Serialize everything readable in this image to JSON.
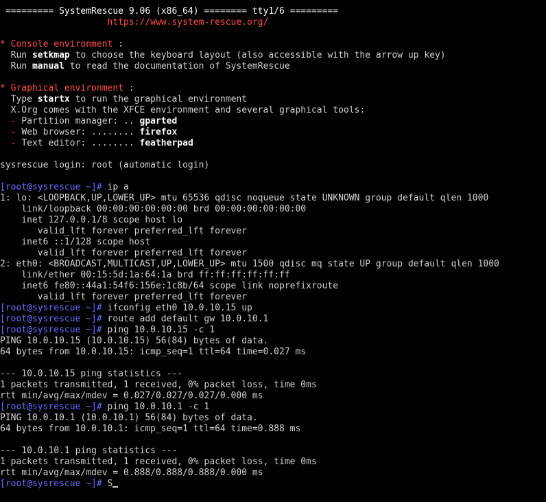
{
  "colors": {
    "background": "#000000",
    "text": "#d2d2d2",
    "bright": "#ffffff",
    "red": "#ff4d4d",
    "prompt": "#6b6bff"
  },
  "lines": [
    {
      "segs": [
        {
          "t": " ========= SystemRescue 9.06 (x86_64) ======== tty1/6 =========",
          "c": "w"
        }
      ]
    },
    {
      "segs": [
        {
          "t": "                    https://www.system-rescue.org/",
          "c": "r"
        }
      ]
    },
    {
      "segs": [
        {
          "t": "",
          "c": ""
        }
      ]
    },
    {
      "segs": [
        {
          "t": "* Console environment",
          "c": "r"
        },
        {
          "t": " :",
          "c": ""
        }
      ]
    },
    {
      "segs": [
        {
          "t": "  Run ",
          "c": ""
        },
        {
          "t": "setkmap",
          "c": "b"
        },
        {
          "t": " to choose the keyboard layout (also accessible with the arrow up key)",
          "c": ""
        }
      ]
    },
    {
      "segs": [
        {
          "t": "  Run ",
          "c": ""
        },
        {
          "t": "manual",
          "c": "b"
        },
        {
          "t": " to read the documentation of SystemRescue",
          "c": ""
        }
      ]
    },
    {
      "segs": [
        {
          "t": "",
          "c": ""
        }
      ]
    },
    {
      "segs": [
        {
          "t": "* Graphical environment",
          "c": "r"
        },
        {
          "t": " :",
          "c": ""
        }
      ]
    },
    {
      "segs": [
        {
          "t": "  Type ",
          "c": ""
        },
        {
          "t": "startx",
          "c": "b"
        },
        {
          "t": " to run the graphical environment",
          "c": ""
        }
      ]
    },
    {
      "segs": [
        {
          "t": "  X.Org comes with the XFCE environment and several graphical tools:",
          "c": ""
        }
      ]
    },
    {
      "segs": [
        {
          "t": "  - ",
          "c": "r"
        },
        {
          "t": "Partition manager: .. ",
          "c": ""
        },
        {
          "t": "gparted",
          "c": "b"
        }
      ]
    },
    {
      "segs": [
        {
          "t": "  - ",
          "c": "r"
        },
        {
          "t": "Web browser: ........ ",
          "c": ""
        },
        {
          "t": "firefox",
          "c": "b"
        }
      ]
    },
    {
      "segs": [
        {
          "t": "  - ",
          "c": "r"
        },
        {
          "t": "Text editor: ........ ",
          "c": ""
        },
        {
          "t": "featherpad",
          "c": "b"
        }
      ]
    },
    {
      "segs": [
        {
          "t": "",
          "c": ""
        }
      ]
    },
    {
      "segs": [
        {
          "t": "sysrescue login: root (automatic login)",
          "c": ""
        }
      ]
    },
    {
      "segs": [
        {
          "t": "",
          "c": ""
        }
      ]
    },
    {
      "segs": [
        {
          "t": "[root@sysrescue ~]#",
          "c": "p"
        },
        {
          "t": " ip a",
          "c": ""
        }
      ]
    },
    {
      "segs": [
        {
          "t": "1: lo: <LOOPBACK,UP,LOWER_UP> mtu 65536 qdisc noqueue state UNKNOWN group default qlen 1000",
          "c": ""
        }
      ]
    },
    {
      "segs": [
        {
          "t": "    link/loopback 00:00:00:00:00:00 brd 00:00:00:00:00:00",
          "c": ""
        }
      ]
    },
    {
      "segs": [
        {
          "t": "    inet 127.0.0.1/8 scope host lo",
          "c": ""
        }
      ]
    },
    {
      "segs": [
        {
          "t": "       valid_lft forever preferred_lft forever",
          "c": ""
        }
      ]
    },
    {
      "segs": [
        {
          "t": "    inet6 ::1/128 scope host",
          "c": ""
        }
      ]
    },
    {
      "segs": [
        {
          "t": "       valid_lft forever preferred_lft forever",
          "c": ""
        }
      ]
    },
    {
      "segs": [
        {
          "t": "2: eth0: <BROADCAST,MULTICAST,UP,LOWER_UP> mtu 1500 qdisc mq state UP group default qlen 1000",
          "c": ""
        }
      ]
    },
    {
      "segs": [
        {
          "t": "    link/ether 00:15:5d:1a:64:1a brd ff:ff:ff:ff:ff:ff",
          "c": ""
        }
      ]
    },
    {
      "segs": [
        {
          "t": "    inet6 fe80::44a1:54f6:156e:1c8b/64 scope link noprefixroute",
          "c": ""
        }
      ]
    },
    {
      "segs": [
        {
          "t": "       valid_lft forever preferred_lft forever",
          "c": ""
        }
      ]
    },
    {
      "segs": [
        {
          "t": "[root@sysrescue ~]#",
          "c": "p"
        },
        {
          "t": " ifconfig eth0 10.0.10.15 up",
          "c": ""
        }
      ]
    },
    {
      "segs": [
        {
          "t": "[root@sysrescue ~]#",
          "c": "p"
        },
        {
          "t": " route add default gw 10.0.10.1",
          "c": ""
        }
      ]
    },
    {
      "segs": [
        {
          "t": "[root@sysrescue ~]#",
          "c": "p"
        },
        {
          "t": " ping 10.0.10.15 -c 1",
          "c": ""
        }
      ]
    },
    {
      "segs": [
        {
          "t": "PING 10.0.10.15 (10.0.10.15) 56(84) bytes of data.",
          "c": ""
        }
      ]
    },
    {
      "segs": [
        {
          "t": "64 bytes from 10.0.10.15: icmp_seq=1 ttl=64 time=0.027 ms",
          "c": ""
        }
      ]
    },
    {
      "segs": [
        {
          "t": "",
          "c": ""
        }
      ]
    },
    {
      "segs": [
        {
          "t": "--- 10.0.10.15 ping statistics ---",
          "c": ""
        }
      ]
    },
    {
      "segs": [
        {
          "t": "1 packets transmitted, 1 received, 0% packet loss, time 0ms",
          "c": ""
        }
      ]
    },
    {
      "segs": [
        {
          "t": "rtt min/avg/max/mdev = 0.027/0.027/0.027/0.000 ms",
          "c": ""
        }
      ]
    },
    {
      "segs": [
        {
          "t": "[root@sysrescue ~]#",
          "c": "p"
        },
        {
          "t": " ping 10.0.10.1 -c 1",
          "c": ""
        }
      ]
    },
    {
      "segs": [
        {
          "t": "PING 10.0.10.1 (10.0.10.1) 56(84) bytes of data.",
          "c": ""
        }
      ]
    },
    {
      "segs": [
        {
          "t": "64 bytes from 10.0.10.1: icmp_seq=1 ttl=64 time=0.888 ms",
          "c": ""
        }
      ]
    },
    {
      "segs": [
        {
          "t": "",
          "c": ""
        }
      ]
    },
    {
      "segs": [
        {
          "t": "--- 10.0.10.1 ping statistics ---",
          "c": ""
        }
      ]
    },
    {
      "segs": [
        {
          "t": "1 packets transmitted, 1 received, 0% packet loss, time 0ms",
          "c": ""
        }
      ]
    },
    {
      "segs": [
        {
          "t": "rtt min/avg/max/mdev = 0.888/0.888/0.888/0.000 ms",
          "c": ""
        }
      ]
    }
  ],
  "prompt": {
    "label": "[root@sysrescue ~]#",
    "input": " S"
  }
}
